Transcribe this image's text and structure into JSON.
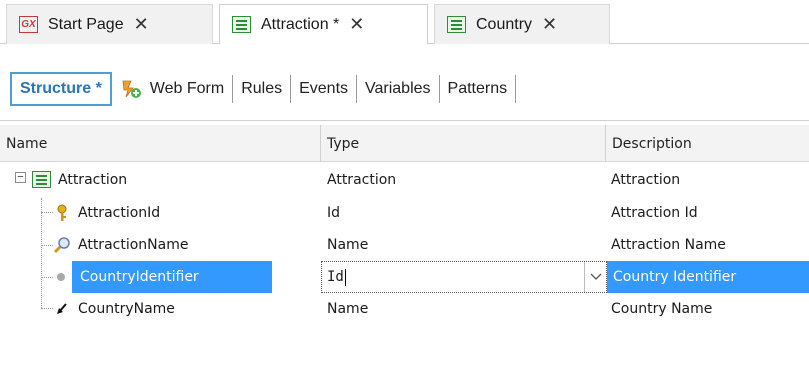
{
  "tabs": [
    {
      "label": "Start Page",
      "close": "✕",
      "icon": "gx-logo-icon",
      "active": false
    },
    {
      "label": "Attraction *",
      "close": "✕",
      "icon": "transaction-icon",
      "active": true
    },
    {
      "label": "Country",
      "close": "✕",
      "icon": "transaction-icon",
      "active": false
    }
  ],
  "gx_logo_text": "GX",
  "subtabs": [
    "Structure *",
    "Web Form",
    "Rules",
    "Events",
    "Variables",
    "Patterns"
  ],
  "columns": {
    "name": "Name",
    "type": "Type",
    "description": "Description"
  },
  "rows": [
    {
      "name": "Attraction",
      "type": "Attraction",
      "description": "Attraction",
      "icon": "transaction-icon"
    },
    {
      "name": "AttractionId",
      "type": "Id",
      "description": "Attraction Id",
      "icon": "key-icon"
    },
    {
      "name": "AttractionName",
      "type": "Name",
      "description": "Attraction Name",
      "icon": "magnifier-icon"
    },
    {
      "name": "CountryIdentifier",
      "type": "Id",
      "description": "Country Identifier",
      "icon": "dot-icon",
      "selected": true
    },
    {
      "name": "CountryName",
      "type": "Name",
      "description": "Country Name",
      "icon": "inferred-arrow-icon"
    }
  ],
  "colors": {
    "selection": "#3399ff",
    "accent": "#4a9fd9",
    "gx_red": "#c23b3b",
    "transaction_green": "#2e8b3a"
  }
}
